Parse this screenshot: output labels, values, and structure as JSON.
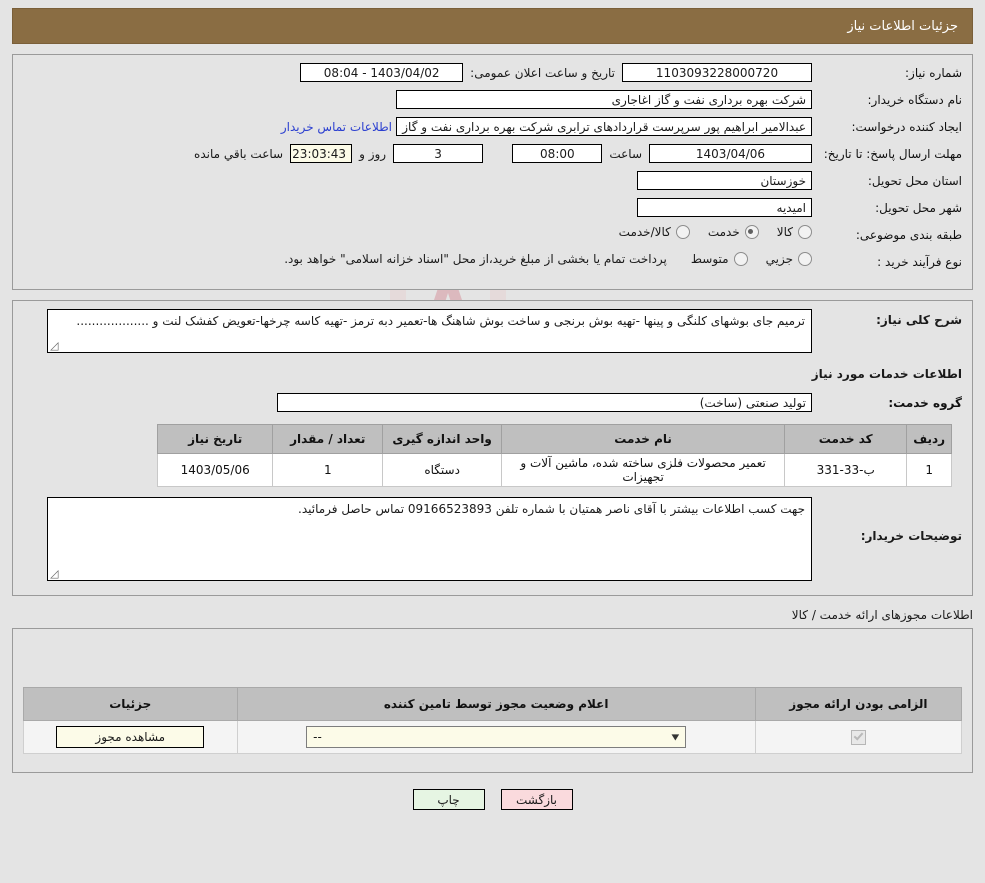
{
  "header": {
    "title": "جزئیات اطلاعات نیاز"
  },
  "need_info": {
    "need_no_label": "شماره نیاز:",
    "need_no_value": "1103093228000720",
    "announce_label": "تاریخ و ساعت اعلان عمومی:",
    "announce_value": "1403/04/02 - 08:04",
    "buyer_org_label": "نام دستگاه خریدار:",
    "buyer_org_value": "شرکت بهره برداری نفت و گاز اغاجاری",
    "creator_label": "ایجاد کننده درخواست:",
    "creator_value": "عبدالامیر ابراهیم پور سرپرست قراردادهای ترابری شرکت بهره برداری نفت و گاز",
    "contact_link": "اطلاعات تماس خریدار",
    "deadline_label": "مهلت ارسال پاسخ: تا تاریخ:",
    "deadline_date": "1403/04/06",
    "deadline_hour_label": "ساعت",
    "deadline_hour": "08:00",
    "days_value": "3",
    "days_label": "روز و",
    "countdown_value": "23:03:43",
    "countdown_label": "ساعت باقي مانده",
    "province_label": "استان محل تحویل:",
    "province_value": "خوزستان",
    "city_label": "شهر محل تحویل:",
    "city_value": "امیدیه",
    "category_label": "طبقه بندی موضوعی:",
    "category_options": [
      {
        "label": "کالا",
        "checked": false
      },
      {
        "label": "خدمت",
        "checked": true
      },
      {
        "label": "کالا/خدمت",
        "checked": false
      }
    ],
    "process_label": "نوع فرآیند خرید :",
    "process_options": [
      {
        "label": "جزیي",
        "checked": false
      },
      {
        "label": "متوسط",
        "checked": false
      }
    ],
    "process_note": "پرداخت تمام یا بخشی از مبلغ خرید،از محل \"اسناد خزانه اسلامی\" خواهد بود."
  },
  "description": {
    "label": "شرح کلی نیاز:",
    "value": "ترمیم جای بوشهای کلنگی و پینها -تهیه بوش برنجی و ساخت بوش شاهنگ ها-تعمیر دبه ترمز -تهیه کاسه چرخها-تعویض کفشک لنت و ..................."
  },
  "services": {
    "section_title": "اطلاعات خدمات مورد نیاز",
    "group_label": "گروه خدمت:",
    "group_value": "تولید صنعتی (ساخت)",
    "columns": [
      "ردیف",
      "کد خدمت",
      "نام خدمت",
      "واحد اندازه گیری",
      "تعداد / مقدار",
      "تاریخ نیاز"
    ],
    "rows": [
      {
        "row_no": "1",
        "code": "ب-33-331",
        "name": "تعمیر محصولات فلزی ساخته شده، ماشین آلات و تجهیزات",
        "unit": "دستگاه",
        "qty": "1",
        "need_date": "1403/05/06"
      }
    ]
  },
  "buyer_comment": {
    "label": "توضیحات خریدار:",
    "value": "جهت کسب اطلاعات بیشتر با آقای ناصر همتیان با شماره تلفن 09166523893 تماس حاصل فرمائید."
  },
  "permits": {
    "section_label": "اطلاعات مجوزهای ارائه خدمت / کالا",
    "columns": [
      "الزامی بودن ارائه مجوز",
      "اعلام وضعیت مجوز توسط تامین کننده",
      "جزئیات"
    ],
    "rows": [
      {
        "required_checked": true,
        "status_value": "--",
        "detail_button": "مشاهده مجوز"
      }
    ]
  },
  "footer": {
    "back_button": "بازگشت",
    "print_button": "چاپ"
  },
  "colors": {
    "header_bg": "#8a6d43",
    "link": "#2b3fd0",
    "back_btn": "#fadadd",
    "print_btn": "#e6f5e3",
    "table_header": "#bfbfbf",
    "cream_field": "#fcfbe8"
  },
  "watermark": {
    "text": "AriaTender.net"
  }
}
